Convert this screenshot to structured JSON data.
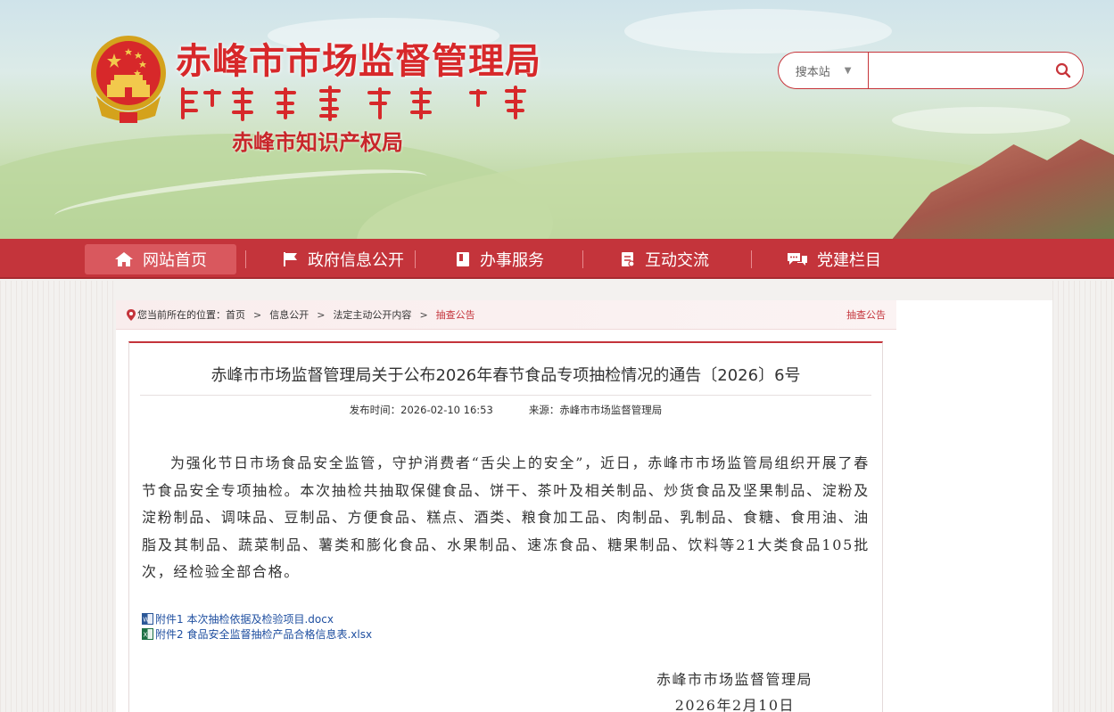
{
  "header": {
    "title": "赤峰市市场监督管理局",
    "subtitle": "赤峰市知识产权局",
    "mongolian_script": "ᠬᠣᠯᠠᠨᠬᠠᠳᠠ ᠬᠣᠲᠠ",
    "colors": {
      "brand_red": "#d7282a",
      "nav_red": "#c4343b"
    }
  },
  "search": {
    "scope_label": "搜本站",
    "scope_caret": "▼",
    "placeholder": "",
    "icon": "search-icon"
  },
  "nav": {
    "items": [
      {
        "label": "网站首页",
        "icon": "home-icon",
        "active": true
      },
      {
        "label": "政府信息公开",
        "icon": "flag-icon",
        "active": false
      },
      {
        "label": "办事服务",
        "icon": "book-icon",
        "active": false
      },
      {
        "label": "互动交流",
        "icon": "document-icon",
        "active": false
      },
      {
        "label": "党建栏目",
        "icon": "chat-icon",
        "active": false
      }
    ]
  },
  "breadcrumb": {
    "prefix": "您当前所在的位置：",
    "items": [
      "首页",
      "信息公开",
      "法定主动公开内容",
      "抽查公告"
    ],
    "separator": ">",
    "right_label": "抽查公告"
  },
  "article": {
    "title": "赤峰市市场监督管理局关于公布2026年春节食品专项抽检情况的通告〔2026〕6号",
    "publish_time": "发布时间：2026-02-10 16:53",
    "source": "来源：赤峰市市场监督管理局",
    "body": "为强化节日市场食品安全监管，守护消费者“舌尖上的安全”，近日，赤峰市市场监管局组织开展了春节食品安全专项抽检。本次抽检共抽取保健食品、饼干、茶叶及相关制品、炒货食品及坚果制品、淀粉及淀粉制品、调味品、豆制品、方便食品、糕点、酒类、粮食加工品、肉制品、乳制品、食糖、食用油、油脂及其制品、蔬菜制品、薯类和膨化食品、水果制品、速冻食品、糖果制品、饮料等21大类食品105批次，经检验全部合格。",
    "attachments": [
      {
        "label": "附件1 本次抽检依据及检验项目.docx",
        "icon": "word-doc-icon"
      },
      {
        "label": "附件2 食品安全监督抽检产品合格信息表.xlsx",
        "icon": "excel-doc-icon"
      }
    ],
    "signature_org": "赤峰市市场监督管理局",
    "signature_date": "2026年2月10日"
  }
}
